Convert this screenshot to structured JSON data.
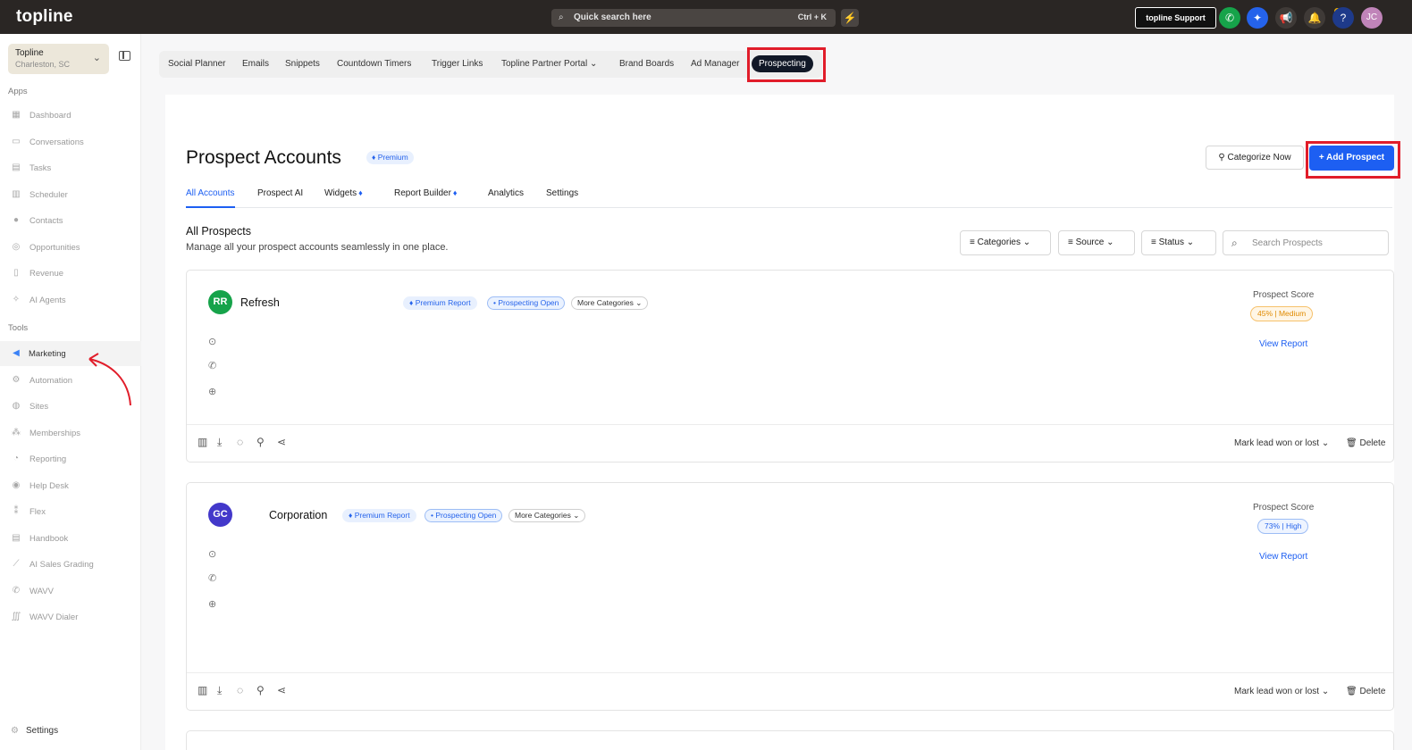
{
  "topbar": {
    "logo": "topline",
    "search_placeholder": "Quick search here",
    "search_shortcut": "Ctrl + K",
    "support_label": "topline Support",
    "avatar_initials": "JC"
  },
  "sidebar": {
    "account_name": "Topline",
    "account_location": "Charleston, SC",
    "apps_label": "Apps",
    "apps": [
      {
        "label": "Dashboard",
        "icon": "dashboard-icon"
      },
      {
        "label": "Conversations",
        "icon": "chat-icon"
      },
      {
        "label": "Tasks",
        "icon": "tasks-icon"
      },
      {
        "label": "Scheduler",
        "icon": "calendar-icon"
      },
      {
        "label": "Contacts",
        "icon": "person-icon"
      },
      {
        "label": "Opportunities",
        "icon": "target-icon"
      },
      {
        "label": "Revenue",
        "icon": "document-icon"
      },
      {
        "label": "AI Agents",
        "icon": "sparkle-icon"
      }
    ],
    "tools_label": "Tools",
    "tools": [
      {
        "label": "Marketing",
        "icon": "megaphone-icon"
      },
      {
        "label": "Automation",
        "icon": "gear-icon"
      },
      {
        "label": "Sites",
        "icon": "globe-icon"
      },
      {
        "label": "Memberships",
        "icon": "group-icon"
      },
      {
        "label": "Reporting",
        "icon": "pie-chart-icon"
      },
      {
        "label": "Help Desk",
        "icon": "help-icon"
      },
      {
        "label": "Flex",
        "icon": "people-icon"
      },
      {
        "label": "Handbook",
        "icon": "book-icon"
      },
      {
        "label": "AI Sales Grading",
        "icon": "line-chart-icon"
      },
      {
        "label": "WAVV",
        "icon": "phone-icon"
      },
      {
        "label": "WAVV Dialer",
        "icon": "dialer-icon"
      }
    ],
    "settings_label": "Settings"
  },
  "marketing_tabs": [
    "Social Planner",
    "Emails",
    "Snippets",
    "Countdown Timers",
    "Trigger Links",
    "Topline Partner Portal",
    "Brand Boards",
    "Ad Manager",
    "Prospecting"
  ],
  "page": {
    "title": "Prospect Accounts",
    "premium_badge": "Premium",
    "categorize_label": "Categorize Now",
    "add_prospect_label": "+ Add Prospect",
    "subtabs": [
      "All Accounts",
      "Prospect AI",
      "Widgets",
      "Report Builder",
      "Analytics",
      "Settings"
    ],
    "section_title": "All Prospects",
    "section_subtitle": "Manage all your prospect accounts seamlessly in one place.",
    "filters": [
      "Categories",
      "Source",
      "Status"
    ],
    "search_placeholder": "Search Prospects"
  },
  "prospects": [
    {
      "initials": "RR",
      "name": "Refresh",
      "avatar_color": "#16a34a",
      "premium_report": "Premium Report",
      "status": "• Prospecting Open",
      "more_categories": "More Categories",
      "score_label": "Prospect Score",
      "score": "45%",
      "score_level": "Medium",
      "view_report": "View Report",
      "mark_label": "Mark lead won or lost",
      "delete_label": "Delete"
    },
    {
      "initials": "GC",
      "name": "Corporation",
      "avatar_color": "#4338ca",
      "premium_report": "Premium Report",
      "status": "• Prospecting Open",
      "more_categories": "More Categories",
      "score_label": "Prospect Score",
      "score": "73%",
      "score_level": "High",
      "view_report": "View Report",
      "mark_label": "Mark lead won or lost",
      "delete_label": "Delete"
    }
  ],
  "colors": {
    "accent": "#1d5ff2",
    "highlight": "#e11d2a",
    "topbar": "#2a2624"
  }
}
